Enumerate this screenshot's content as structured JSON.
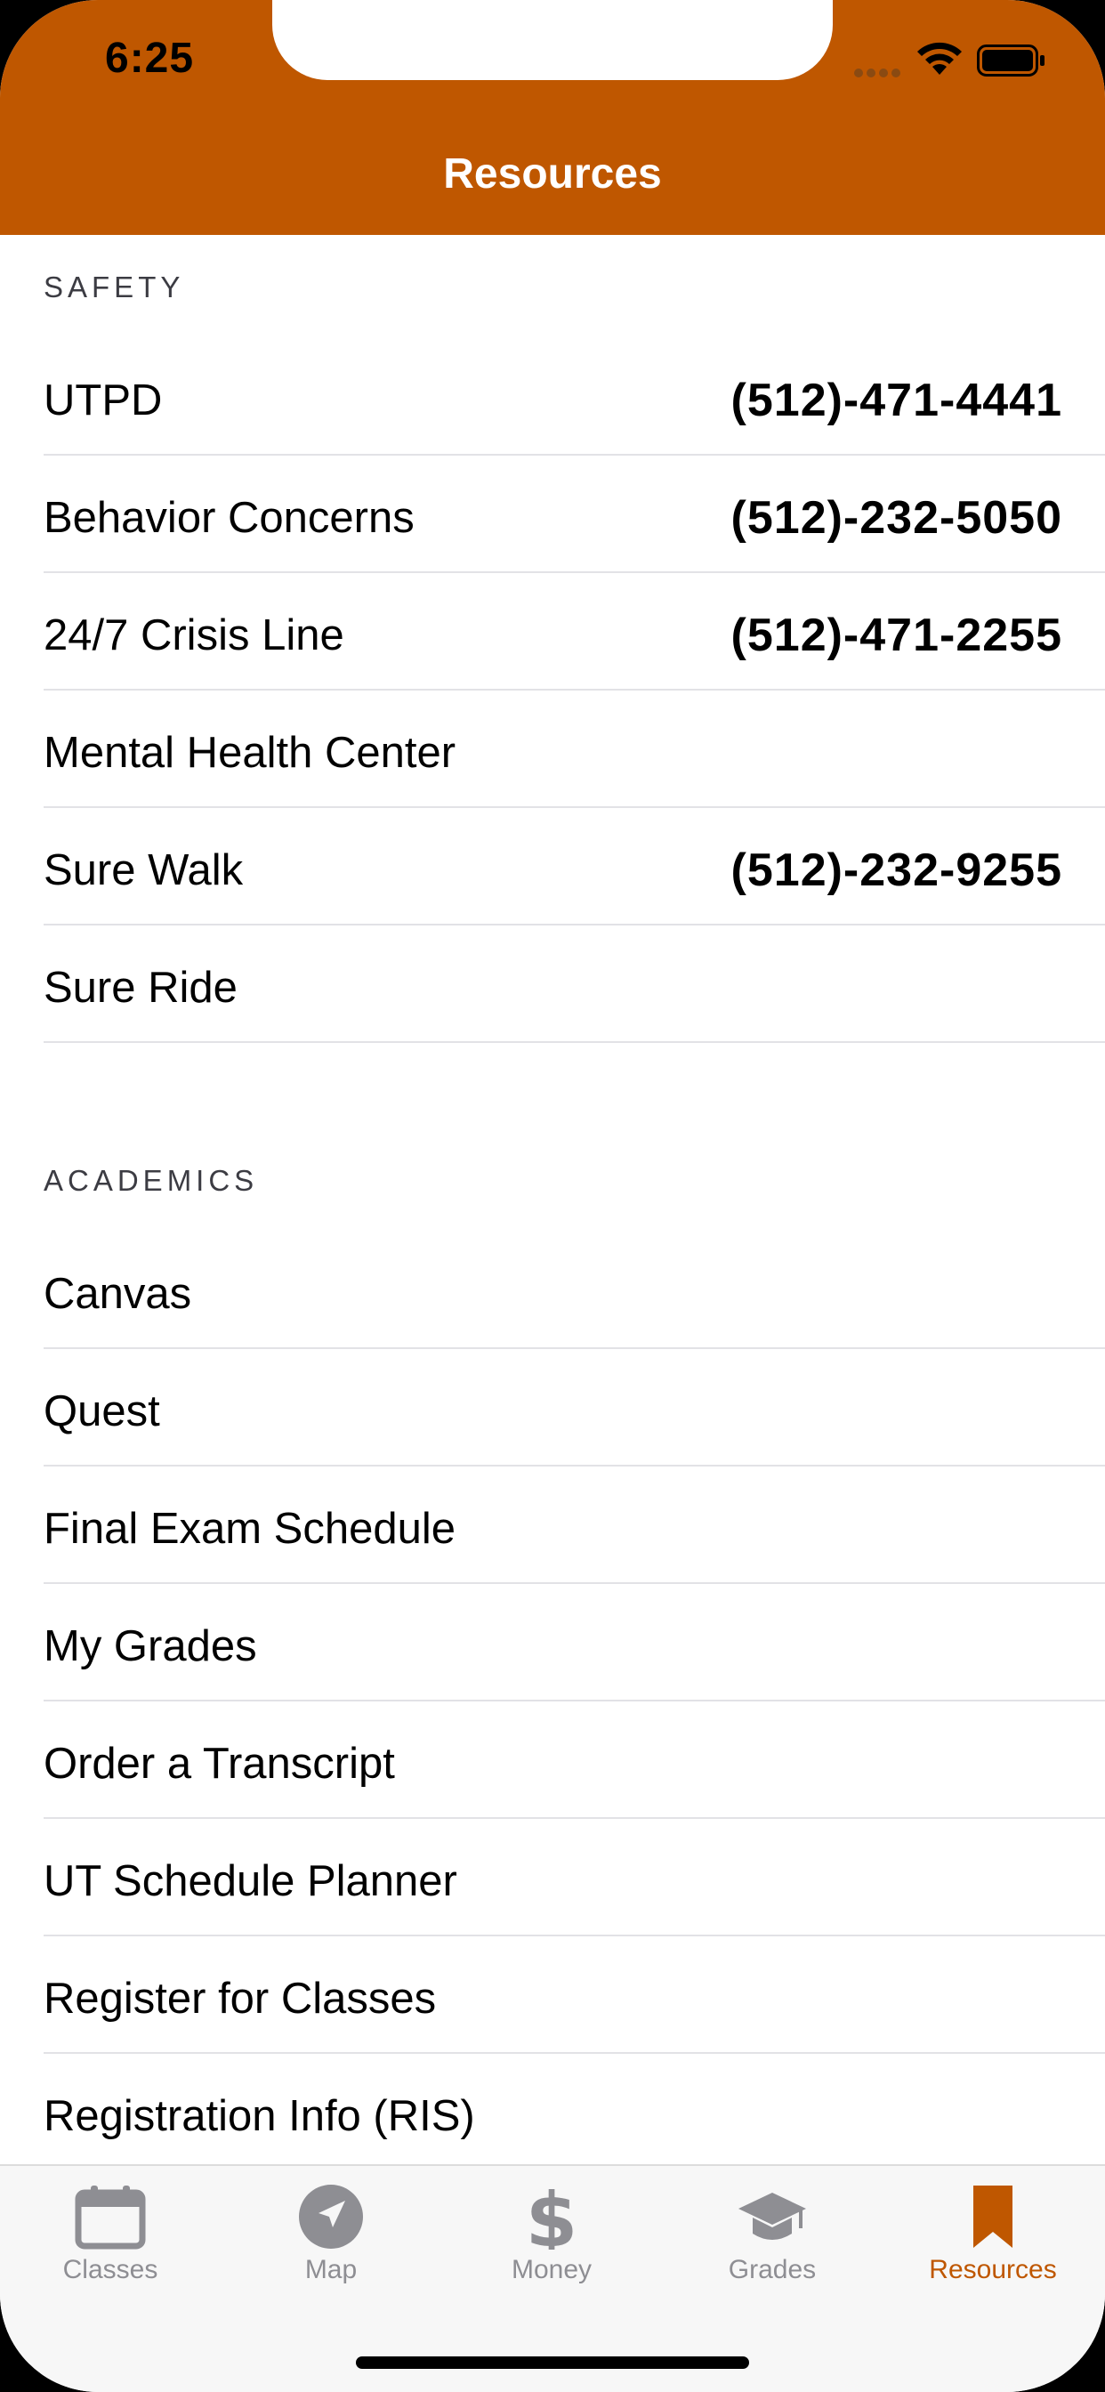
{
  "status_bar": {
    "time": "6:25"
  },
  "header": {
    "title": "Resources",
    "color": "#bf5700"
  },
  "sections": [
    {
      "title": "SAFETY",
      "rows": [
        {
          "label": "UTPD",
          "phone": "(512)-471-4441"
        },
        {
          "label": "Behavior Concerns",
          "phone": "(512)-232-5050"
        },
        {
          "label": "24/7 Crisis Line",
          "phone": "(512)-471-2255"
        },
        {
          "label": "Mental Health Center",
          "phone": ""
        },
        {
          "label": "Sure Walk",
          "phone": "(512)-232-9255"
        },
        {
          "label": "Sure Ride",
          "phone": ""
        }
      ]
    },
    {
      "title": "ACADEMICS",
      "rows": [
        {
          "label": "Canvas"
        },
        {
          "label": "Quest"
        },
        {
          "label": "Final Exam Schedule"
        },
        {
          "label": "My Grades"
        },
        {
          "label": "Order a Transcript"
        },
        {
          "label": "UT Schedule Planner"
        },
        {
          "label": "Register for Classes"
        },
        {
          "label": "Registration Info (RIS)"
        }
      ]
    }
  ],
  "tabbar": {
    "active_color": "#bf5700",
    "inactive_color": "#8e8e93",
    "tabs": [
      {
        "label": "Classes",
        "icon": "calendar-icon"
      },
      {
        "label": "Map",
        "icon": "location-arrow-icon"
      },
      {
        "label": "Money",
        "icon": "dollar-icon"
      },
      {
        "label": "Grades",
        "icon": "graduation-cap-icon"
      },
      {
        "label": "Resources",
        "icon": "bookmark-icon",
        "active": true
      }
    ]
  }
}
